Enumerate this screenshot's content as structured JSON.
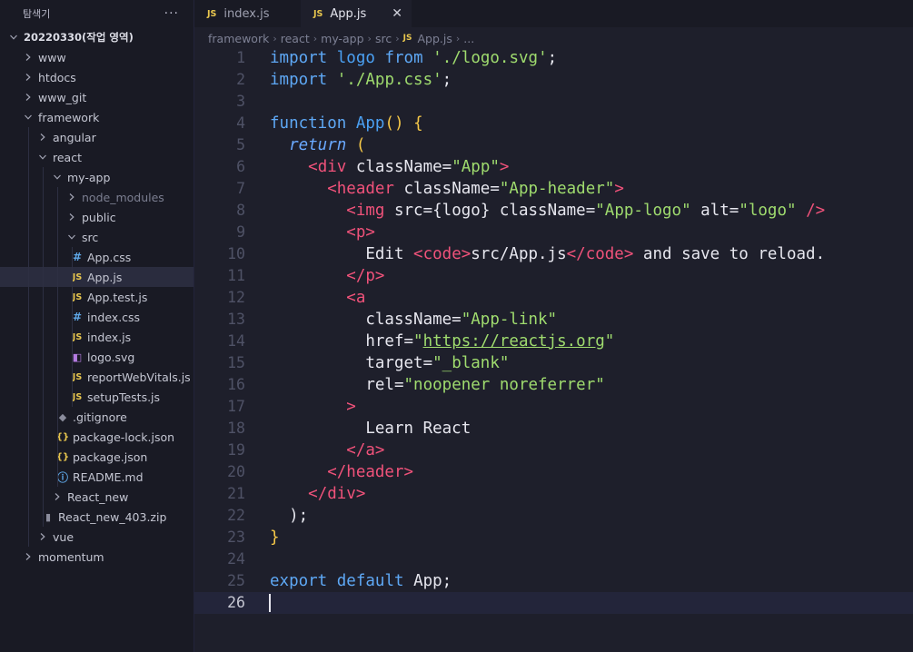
{
  "sidebar": {
    "title": "탐색기",
    "more": "···",
    "tree": [
      {
        "label": "20220330(작업 영역)",
        "depth": 0,
        "type": "root",
        "open": true
      },
      {
        "label": "www",
        "depth": 1,
        "type": "folder",
        "open": false
      },
      {
        "label": "htdocs",
        "depth": 1,
        "type": "folder",
        "open": false
      },
      {
        "label": "www_git",
        "depth": 1,
        "type": "folder",
        "open": false
      },
      {
        "label": "framework",
        "depth": 1,
        "type": "folder",
        "open": true
      },
      {
        "label": "angular",
        "depth": 2,
        "type": "folder",
        "open": false
      },
      {
        "label": "react",
        "depth": 2,
        "type": "folder",
        "open": true
      },
      {
        "label": "my-app",
        "depth": 3,
        "type": "folder",
        "open": true
      },
      {
        "label": "node_modules",
        "depth": 4,
        "type": "folder",
        "open": false,
        "dim": true
      },
      {
        "label": "public",
        "depth": 4,
        "type": "folder",
        "open": false
      },
      {
        "label": "src",
        "depth": 4,
        "type": "folder",
        "open": true
      },
      {
        "label": "App.css",
        "depth": 5,
        "type": "css"
      },
      {
        "label": "App.js",
        "depth": 5,
        "type": "js",
        "selected": true
      },
      {
        "label": "App.test.js",
        "depth": 5,
        "type": "js"
      },
      {
        "label": "index.css",
        "depth": 5,
        "type": "css"
      },
      {
        "label": "index.js",
        "depth": 5,
        "type": "js"
      },
      {
        "label": "logo.svg",
        "depth": 5,
        "type": "svg"
      },
      {
        "label": "reportWebVitals.js",
        "depth": 5,
        "type": "js"
      },
      {
        "label": "setupTests.js",
        "depth": 5,
        "type": "js"
      },
      {
        "label": ".gitignore",
        "depth": 4,
        "type": "git"
      },
      {
        "label": "package-lock.json",
        "depth": 4,
        "type": "json"
      },
      {
        "label": "package.json",
        "depth": 4,
        "type": "json"
      },
      {
        "label": "README.md",
        "depth": 4,
        "type": "info"
      },
      {
        "label": "React_new",
        "depth": 3,
        "type": "folder",
        "open": false
      },
      {
        "label": "React_new_403.zip",
        "depth": 3,
        "type": "zip"
      },
      {
        "label": "vue",
        "depth": 2,
        "type": "folder",
        "open": false
      },
      {
        "label": "momentum",
        "depth": 1,
        "type": "folder",
        "open": false
      }
    ]
  },
  "tabs": [
    {
      "badge": "JS",
      "label": "index.js",
      "active": false
    },
    {
      "badge": "JS",
      "label": "App.js",
      "active": true,
      "close": "✕"
    }
  ],
  "breadcrumb": [
    "framework",
    "react",
    "my-app",
    "src",
    "App.js",
    "..."
  ],
  "breadcrumb_badge": "JS",
  "editor": {
    "current_line": 26,
    "lines": [
      [
        [
          "k",
          "import"
        ],
        [
          "p",
          " "
        ],
        [
          "id",
          "logo"
        ],
        [
          "p",
          " "
        ],
        [
          "k",
          "from"
        ],
        [
          "p",
          " "
        ],
        [
          "s",
          "'./logo.svg'"
        ],
        [
          "p",
          ";"
        ]
      ],
      [
        [
          "k",
          "import"
        ],
        [
          "p",
          " "
        ],
        [
          "s",
          "'./App.css'"
        ],
        [
          "p",
          ";"
        ]
      ],
      [],
      [
        [
          "k",
          "function"
        ],
        [
          "p",
          " "
        ],
        [
          "id",
          "App"
        ],
        [
          "brace",
          "()"
        ],
        [
          "p",
          " "
        ],
        [
          "brace",
          "{"
        ]
      ],
      [
        [
          "p",
          "  "
        ],
        [
          "ret",
          "return"
        ],
        [
          "p",
          " "
        ],
        [
          "brace",
          "("
        ]
      ],
      [
        [
          "p",
          "    "
        ],
        [
          "t",
          "<div"
        ],
        [
          "p",
          " className="
        ],
        [
          "s",
          "\"App\""
        ],
        [
          "t",
          ">"
        ]
      ],
      [
        [
          "p",
          "      "
        ],
        [
          "t",
          "<header"
        ],
        [
          "p",
          " className="
        ],
        [
          "s",
          "\"App-header\""
        ],
        [
          "t",
          ">"
        ]
      ],
      [
        [
          "p",
          "        "
        ],
        [
          "t",
          "<img"
        ],
        [
          "p",
          " src="
        ],
        [
          "p",
          "{logo}"
        ],
        [
          "p",
          " className="
        ],
        [
          "s",
          "\"App-logo\""
        ],
        [
          "p",
          " alt="
        ],
        [
          "s",
          "\"logo\""
        ],
        [
          "p",
          " "
        ],
        [
          "t",
          "/>"
        ]
      ],
      [
        [
          "p",
          "        "
        ],
        [
          "t",
          "<p>"
        ]
      ],
      [
        [
          "p",
          "          Edit "
        ],
        [
          "t",
          "<code>"
        ],
        [
          "p",
          "src/App.js"
        ],
        [
          "t",
          "</code>"
        ],
        [
          "p",
          " and save to reload."
        ]
      ],
      [
        [
          "p",
          "        "
        ],
        [
          "t",
          "</p>"
        ]
      ],
      [
        [
          "p",
          "        "
        ],
        [
          "t",
          "<a"
        ]
      ],
      [
        [
          "p",
          "          className="
        ],
        [
          "s",
          "\"App-link\""
        ]
      ],
      [
        [
          "p",
          "          href="
        ],
        [
          "s",
          "\""
        ],
        [
          "url",
          "https://reactjs.org"
        ],
        [
          "s",
          "\""
        ]
      ],
      [
        [
          "p",
          "          target="
        ],
        [
          "s",
          "\"_blank\""
        ]
      ],
      [
        [
          "p",
          "          rel="
        ],
        [
          "s",
          "\"noopener noreferrer\""
        ]
      ],
      [
        [
          "p",
          "        "
        ],
        [
          "t",
          ">"
        ]
      ],
      [
        [
          "p",
          "          Learn React"
        ]
      ],
      [
        [
          "p",
          "        "
        ],
        [
          "t",
          "</a>"
        ]
      ],
      [
        [
          "p",
          "      "
        ],
        [
          "t",
          "</header>"
        ]
      ],
      [
        [
          "p",
          "    "
        ],
        [
          "t",
          "</div>"
        ]
      ],
      [
        [
          "p",
          "  );"
        ]
      ],
      [
        [
          "brace",
          "}"
        ]
      ],
      [],
      [
        [
          "k",
          "export"
        ],
        [
          "p",
          " "
        ],
        [
          "k",
          "default"
        ],
        [
          "p",
          " App;"
        ]
      ],
      []
    ]
  }
}
